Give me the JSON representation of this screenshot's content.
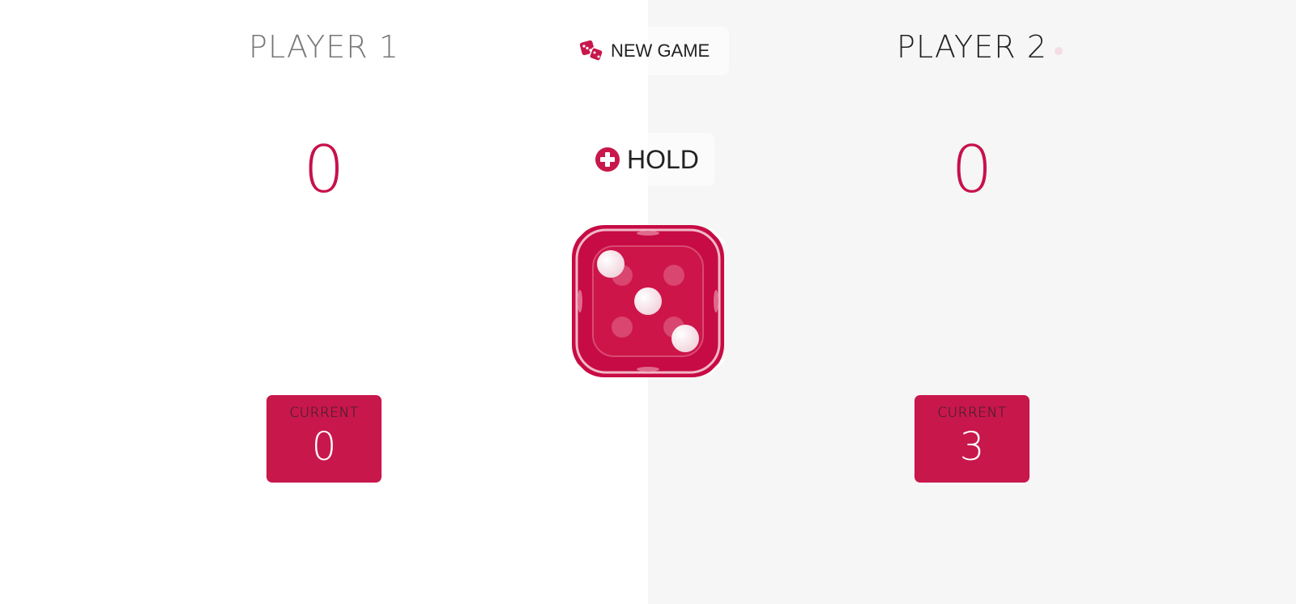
{
  "players": [
    {
      "name": "PLAYER 1",
      "score": "0",
      "current_label": "CURRENT",
      "current": "0"
    },
    {
      "name": "PLAYER 2",
      "score": "0",
      "current_label": "CURRENT",
      "current": "3"
    }
  ],
  "buttons": {
    "new_game": {
      "label": "NEW GAME",
      "icon": "dice-icon"
    },
    "hold": {
      "label": "HOLD",
      "icon": "plus-circle-icon"
    }
  },
  "dice": {
    "value": 3,
    "icon": "dice-face-3"
  },
  "active_player": 2,
  "colors": {
    "accent": "#c8174b",
    "inactive_panel": "#ffffff",
    "active_panel": "#f6f6f6"
  }
}
